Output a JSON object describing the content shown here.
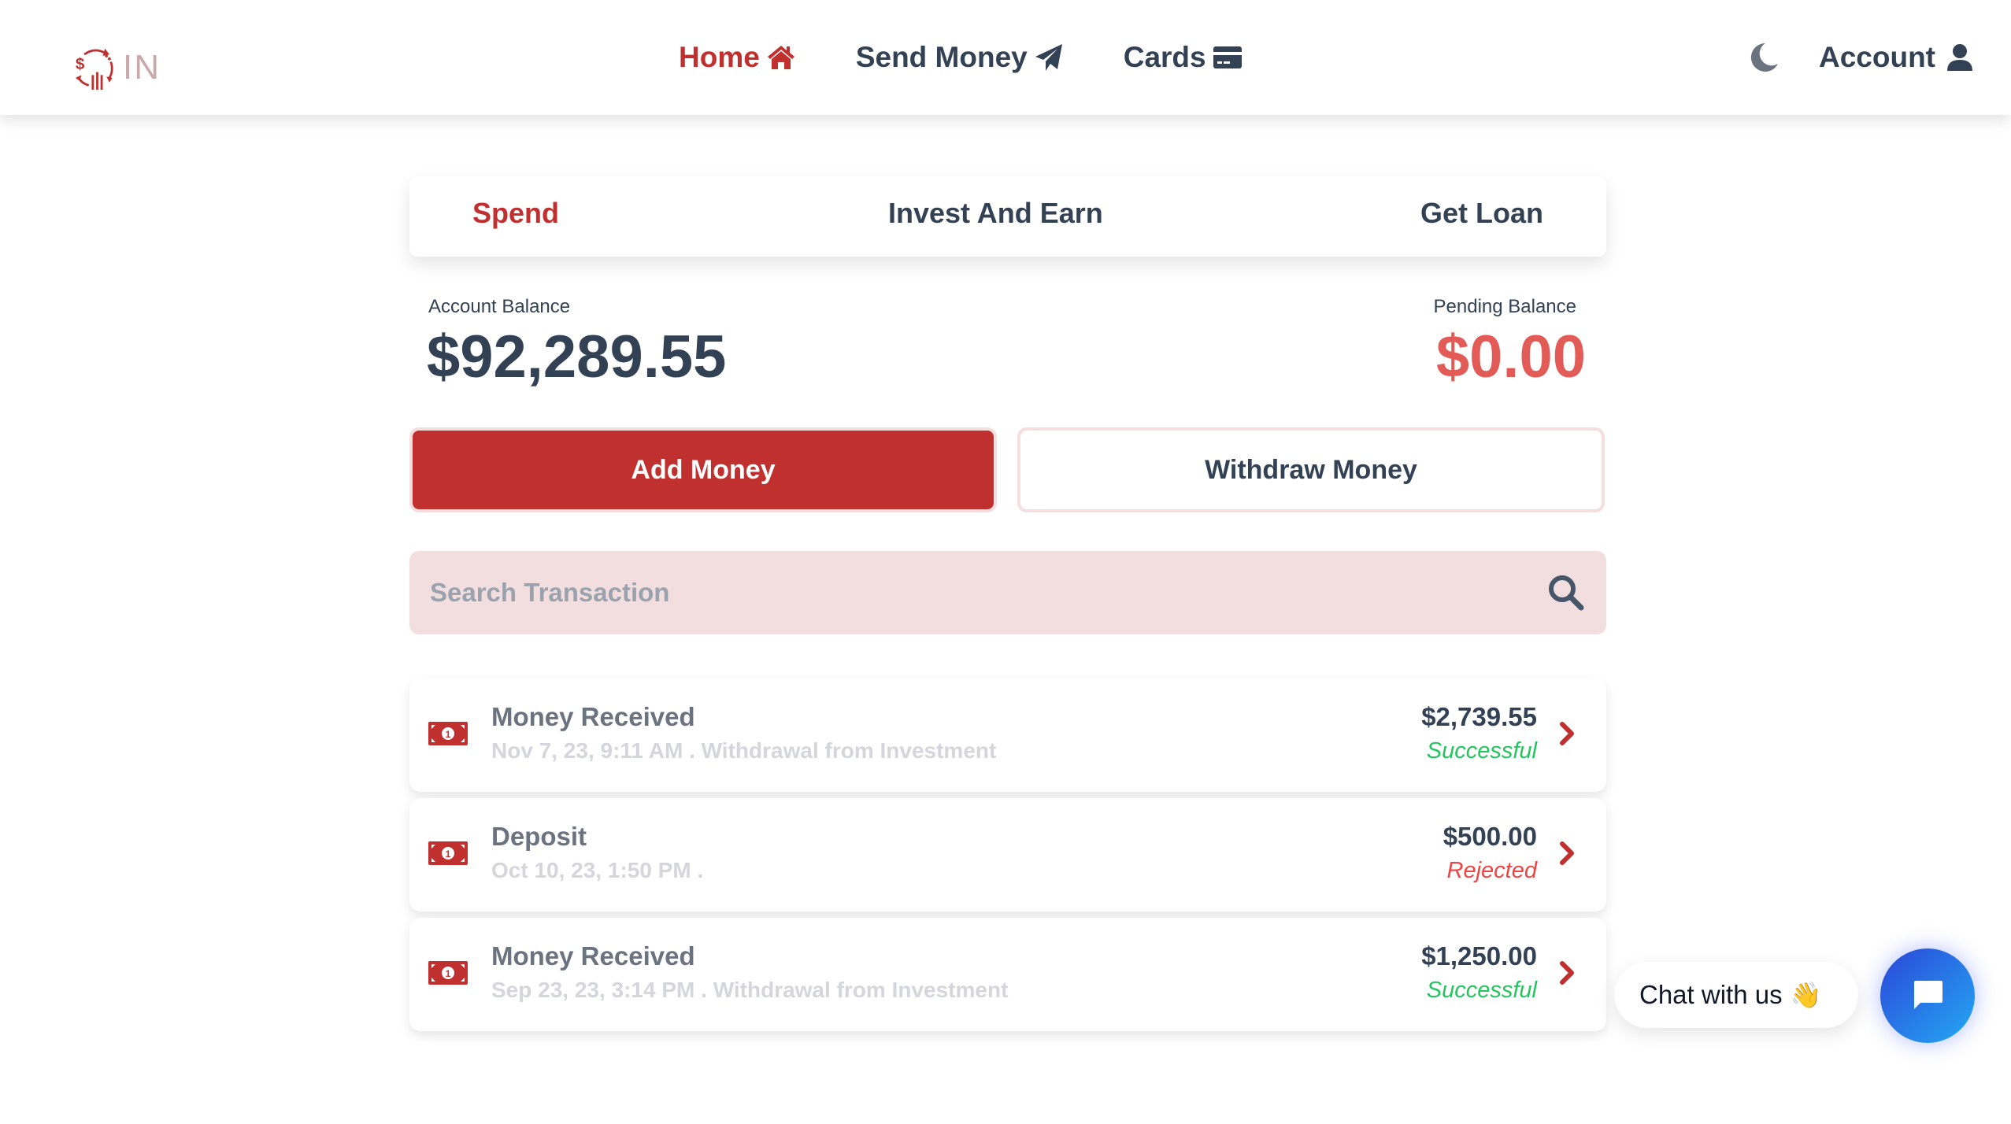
{
  "app": {
    "logo_text": "IN"
  },
  "nav": {
    "items": [
      {
        "label": "Home",
        "icon": "home-icon",
        "active": true
      },
      {
        "label": "Send Money",
        "icon": "paper-plane-icon",
        "active": false
      },
      {
        "label": "Cards",
        "icon": "credit-card-icon",
        "active": false
      }
    ],
    "theme_toggle_icon": "moon-icon",
    "account_label": "Account",
    "account_icon": "user-icon"
  },
  "tabs": [
    {
      "label": "Spend",
      "active": true
    },
    {
      "label": "Invest And Earn",
      "active": false
    },
    {
      "label": "Get Loan",
      "active": false
    }
  ],
  "balances": {
    "account_label": "Account Balance",
    "account_value": "$92,289.55",
    "pending_label": "Pending Balance",
    "pending_value": "$0.00"
  },
  "actions": {
    "add_money": "Add Money",
    "withdraw_money": "Withdraw Money"
  },
  "search": {
    "placeholder": "Search Transaction",
    "value": ""
  },
  "transactions": [
    {
      "title": "Money Received",
      "subtitle": "Nov 7, 23, 9:11 AM . Withdrawal from Investment",
      "amount": "$2,739.55",
      "status": "Successful"
    },
    {
      "title": "Deposit",
      "subtitle": "Oct 10, 23, 1:50 PM .",
      "amount": "$500.00",
      "status": "Rejected"
    },
    {
      "title": "Money Received",
      "subtitle": "Sep 23, 23, 3:14 PM . Withdrawal from Investment",
      "amount": "$1,250.00",
      "status": "Successful"
    }
  ],
  "chat": {
    "label": "Chat with us",
    "emoji": "👋"
  },
  "colors": {
    "brand": "#c0302e",
    "text": "#334155",
    "pending": "#e35b57",
    "success": "#22c55e",
    "rejected": "#ef4444",
    "search_bg": "#f2dede"
  }
}
